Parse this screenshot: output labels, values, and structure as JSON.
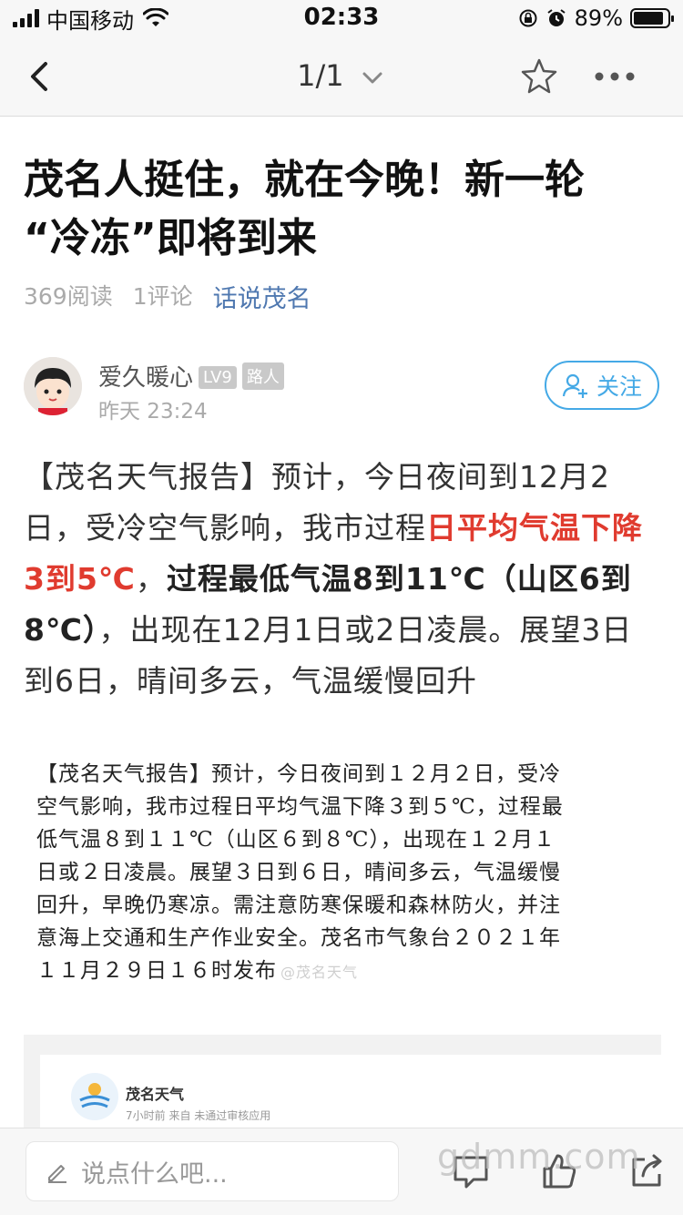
{
  "status_bar": {
    "carrier": "中国移动",
    "time": "02:33",
    "battery_pct": "89%",
    "battery_level": 0.89
  },
  "nav": {
    "page_indicator": "1/1"
  },
  "article": {
    "title_line1": "茂名人挺住，就在今晚！新一轮",
    "title_line2": "“冷冻”即将到来",
    "reads": "369阅读",
    "comments": "1评论",
    "channel": "话说茂名",
    "author": {
      "name": "爱久暖心",
      "level": "LV9",
      "rank": "路人",
      "time": "昨天 23:24",
      "follow_label": "关注"
    },
    "body": {
      "p1": "【茂名天气报告】预计，今日夜间到12月2日，受冷空气影响，我市过程",
      "p2_red": "日平均气温下降3到5℃",
      "p3": "，",
      "p4_bold": "过程最低气温8到11℃（山区6到8℃）",
      "p5": "，出现在12月1日或2日凌晨。展望3日到6日，晴间多云，气温缓慢回升"
    },
    "image_text": {
      "line1": "【茂名天气报告】预计，今日夜间到１２月２日，受冷",
      "line2": "空气影响，我市过程日平均气温下降３到５℃，过程最",
      "line3": "低气温８到１１℃（山区６到８℃），出现在１２月１",
      "line4": "日或２日凌晨。展望３日到６日，晴间多云，气温缓慢",
      "line5": "回升，早晚仍寒凉。需注意防寒保暖和森林防火，并注",
      "line6": "意海上交通和生产作业安全。茂名市气象台２０２１年",
      "line7": "１１月２９日１６时发布",
      "watermark": "@茂名天气"
    },
    "embed": {
      "name": "茂名天气",
      "sub": "7小时前 来自 未通过审核应用",
      "small": "茂名天气"
    }
  },
  "bottom": {
    "comment_placeholder": "说点什么吧...",
    "watermark": "gdmm.com"
  },
  "colors": {
    "accent_blue": "#44a9e6",
    "channel_blue": "#4f78b0",
    "highlight_red": "#e03b2f"
  },
  "icons": [
    "back-icon",
    "chevron-down-icon",
    "star-icon",
    "more-icon",
    "add-user-icon",
    "pencil-icon",
    "comment-icon",
    "like-icon",
    "share-icon"
  ]
}
